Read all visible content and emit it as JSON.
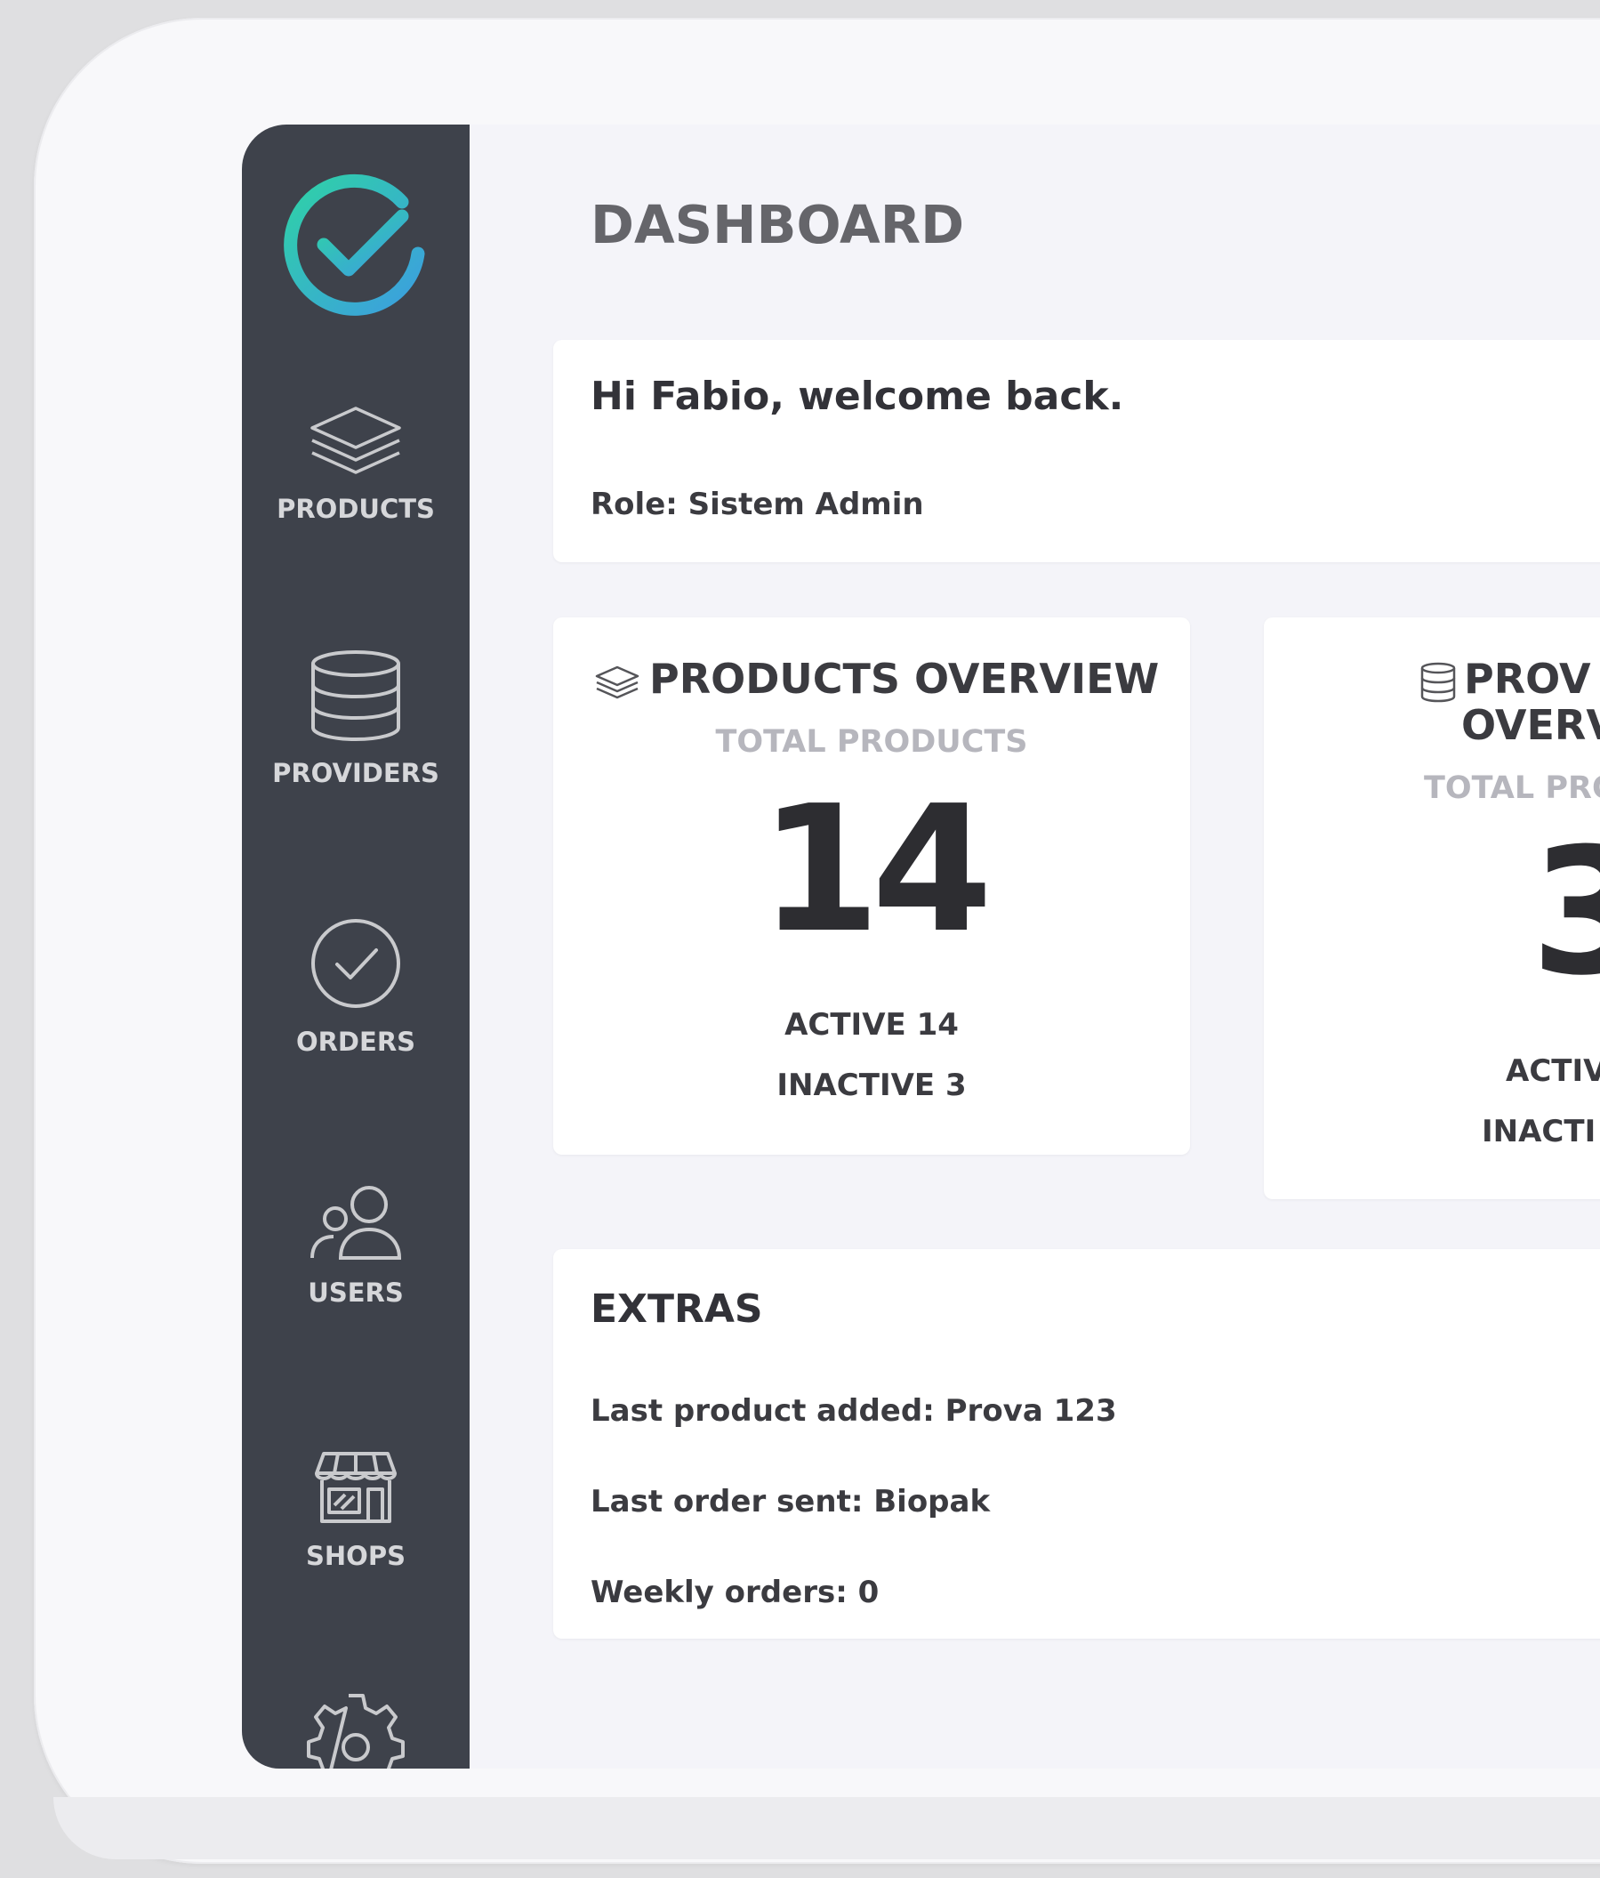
{
  "sidebar": {
    "logo_icon": "check-circle-logo",
    "items": [
      {
        "label": "PRODUCTS",
        "icon": "layers-icon"
      },
      {
        "label": "PROVIDERS",
        "icon": "database-icon"
      },
      {
        "label": "ORDERS",
        "icon": "check-circle-icon"
      },
      {
        "label": "USERS",
        "icon": "users-icon"
      },
      {
        "label": "SHOPS",
        "icon": "shop-icon"
      },
      {
        "label": "",
        "icon": "gear-icon"
      }
    ]
  },
  "header": {
    "title": "DASHBOARD"
  },
  "welcome": {
    "greeting": "Hi Fabio, welcome back.",
    "role": "Role: Sistem Admin"
  },
  "products_overview": {
    "title": "PRODUCTS OVERVIEW",
    "subtitle": "TOTAL PRODUCTS",
    "total": "14",
    "active": "ACTIVE 14",
    "inactive": "INACTIVE 3"
  },
  "providers_overview": {
    "title_line1": "PROV",
    "title_line2": "OVERV",
    "subtitle": "TOTAL PRO",
    "total": "3",
    "active": "ACTIV",
    "inactive": "INACTI"
  },
  "extras": {
    "title": "EXTRAS",
    "last_product": "Last product added: Prova 123",
    "last_order": "Last order sent: Biopak",
    "weekly_orders": "Weekly orders: 0"
  },
  "colors": {
    "sidebar_bg": "#3e424b",
    "main_bg": "#f4f4f9",
    "card_bg": "#ffffff",
    "logo_gradient_start": "#2fd1a7",
    "logo_gradient_end": "#3c9ee0"
  }
}
